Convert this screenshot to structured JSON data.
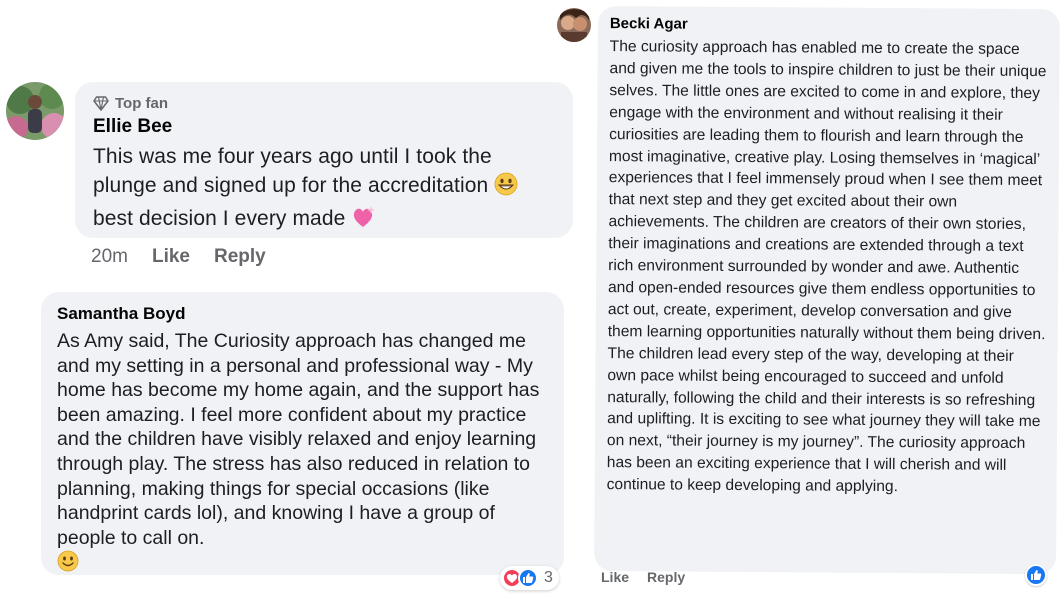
{
  "comments": [
    {
      "badge": "Top fan",
      "badge_icon": "diamond-icon",
      "author": "Ellie Bee",
      "text": "This was me four years ago until I took the plunge and signed up for the accreditation",
      "text_emoji": "grinning-face-icon",
      "text_cont": "best decision I every made",
      "text_cont_emoji": "sparkling-heart-icon",
      "time": "20m",
      "like_label": "Like",
      "reply_label": "Reply"
    },
    {
      "author": "Samantha Boyd",
      "text": "As Amy said, The Curiosity approach has changed me and my setting in a personal and professional way - My home has become my home again, and the support has been amazing. I feel more confident about my practice and the children have visibly relaxed and enjoy learning through play. The stress has also reduced in relation to planning, making things for special occasions (like handprint cards lol), and knowing I have a group of people to call on.",
      "text_emoji": "smiling-face-icon",
      "reactions": [
        "love-reaction-icon",
        "like-reaction-icon"
      ],
      "reaction_count": "3"
    },
    {
      "author": "Becki Agar",
      "text": "The curiosity approach has enabled me to create the space and given me the tools to inspire children to just be their unique selves. The little ones are excited to come in and explore, they engage with the environment and without realising it their curiosities are leading them to flourish and learn through the most imaginative, creative play. Losing themselves in ‘magical’ experiences that I feel immensely proud when I see them meet that next step and they get excited about their own achievements. The children are creators of their own stories, their imaginations and creations are extended through a text rich environment surrounded by wonder and awe. Authentic and open-ended resources give them endless opportunities to act out, create, experiment, develop conversation and give them learning opportunities naturally without them being driven. The children lead every step of the way, developing at their own pace whilst being encouraged to succeed and unfold naturally, following the child and their interests is so refreshing and uplifting. It is exciting to see what journey they will take me on next, “their journey is my journey”. The curiosity approach has been an exciting experience that I will cherish and will continue to keep developing and applying.",
      "like_label": "Like",
      "reply_label": "Reply",
      "reactions": [
        "like-reaction-icon"
      ]
    }
  ],
  "colors": {
    "bubble": "#f0f2f5",
    "meta": "#65676b",
    "like_blue": "#1877f2",
    "love_red": "#f33e58"
  }
}
